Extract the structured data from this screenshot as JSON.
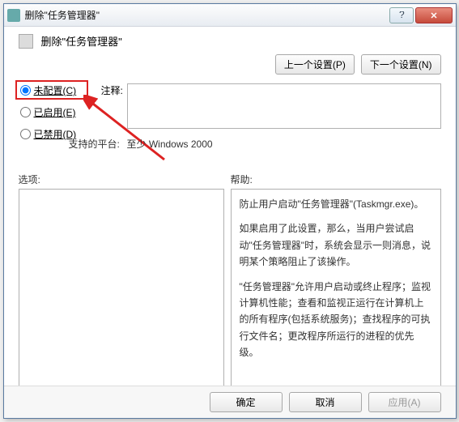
{
  "window": {
    "title": "删除\"任务管理器\""
  },
  "header": {
    "title": "删除\"任务管理器\""
  },
  "nav": {
    "prev": "上一个设置(P)",
    "next": "下一个设置(N)"
  },
  "radios": {
    "not_configured": "未配置(C)",
    "enabled": "已启用(E)",
    "disabled": "已禁用(D)"
  },
  "comment_label": "注释:",
  "support_label": "支持的平台:",
  "support_value": "至少 Windows 2000",
  "options_label": "选项:",
  "help_label": "帮助:",
  "help_text": {
    "p1": "防止用户启动\"任务管理器\"(Taskmgr.exe)。",
    "p2": "如果启用了此设置，那么，当用户尝试启动\"任务管理器\"时，系统会显示一则消息，说明某个策略阻止了该操作。",
    "p3": "\"任务管理器\"允许用户启动或终止程序；监视计算机性能；查看和监视正运行在计算机上的所有程序(包括系统服务)；查找程序的可执行文件名；更改程序所运行的进程的优先级。"
  },
  "buttons": {
    "ok": "确定",
    "cancel": "取消",
    "apply": "应用(A)"
  }
}
